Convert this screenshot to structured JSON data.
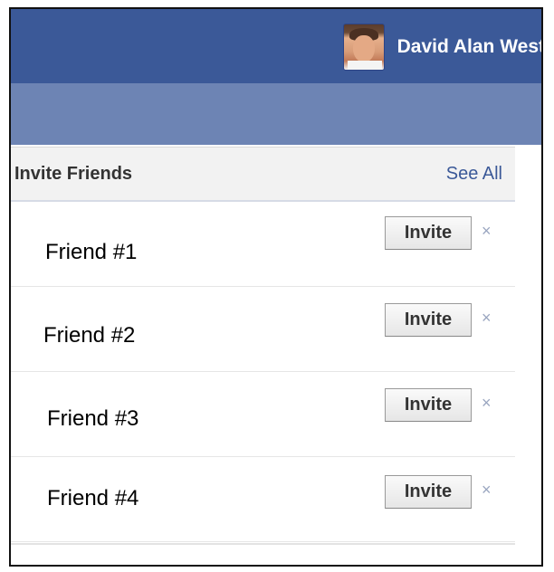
{
  "header": {
    "user_name": "David Alan West",
    "avatar_icon": "profile-photo"
  },
  "panel": {
    "title": "Invite Friends",
    "see_all_label": "See All",
    "friends": [
      {
        "name": "Friend #1",
        "invite_label": "Invite",
        "dismiss_label": "×"
      },
      {
        "name": "Friend #2",
        "invite_label": "Invite",
        "dismiss_label": "×"
      },
      {
        "name": "Friend #3",
        "invite_label": "Invite",
        "dismiss_label": "×"
      },
      {
        "name": "Friend #4",
        "invite_label": "Invite",
        "dismiss_label": "×"
      }
    ]
  },
  "colors": {
    "topbar": "#3b5998",
    "subbar": "#6d84b4",
    "link": "#3b5998"
  }
}
